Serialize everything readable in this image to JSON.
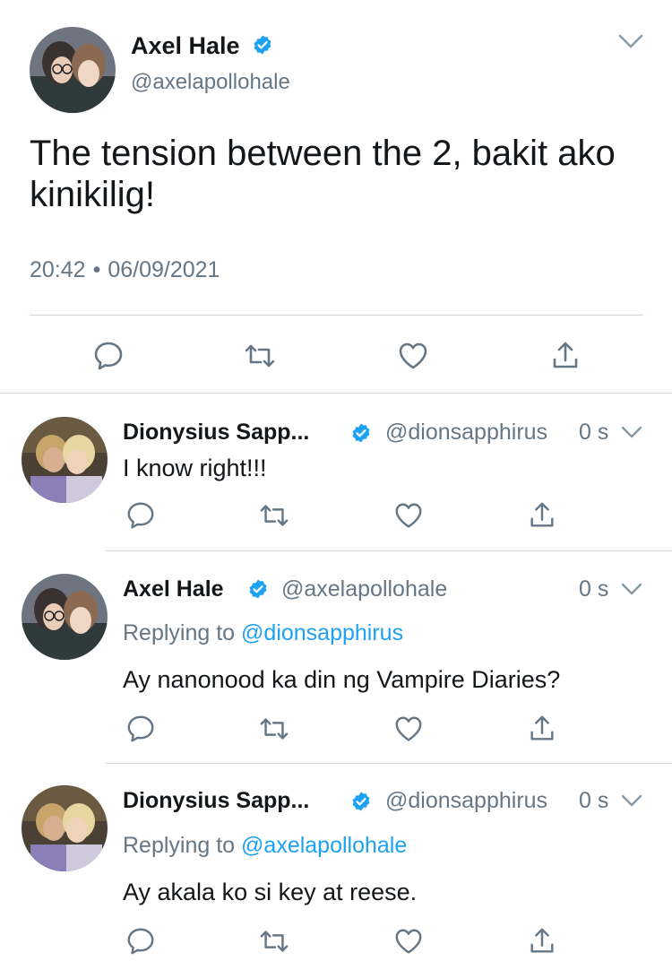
{
  "main_tweet": {
    "author_name": "Axel Hale",
    "handle": "@axelapollohale",
    "text": "The tension between the 2, bakit ako kinikilig!",
    "time": "20:42",
    "separator": "•",
    "date": "06/09/2021",
    "verified": true,
    "menu_icon": "chevron-down-icon"
  },
  "actions": [
    "reply-icon",
    "retweet-icon",
    "like-icon",
    "share-icon"
  ],
  "replies": [
    {
      "author_name": "Dionysius Sapp...",
      "handle": "@dionsapphirus",
      "time": "0 s",
      "replying_prefix": "",
      "replying_to": "",
      "text": "I know right!!!"
    },
    {
      "author_name": "Axel Hale",
      "handle": "@axelapollohale",
      "time": "0 s",
      "replying_prefix": "Replying to",
      "replying_to": "@dionsapphirus",
      "text": "Ay nanonood ka din ng Vampire Diaries?"
    },
    {
      "author_name": "Dionysius Sapp...",
      "handle": "@dionsapphirus",
      "time": "0 s",
      "replying_prefix": "Replying to",
      "replying_to": "@axelapollohale",
      "text": "Ay akala ko si key at reese."
    }
  ],
  "colors": {
    "text": "#14171a",
    "secondary": "#657786",
    "link": "#1da1f2",
    "verified": "#1da1f2",
    "divider": "#ccd6dd"
  }
}
